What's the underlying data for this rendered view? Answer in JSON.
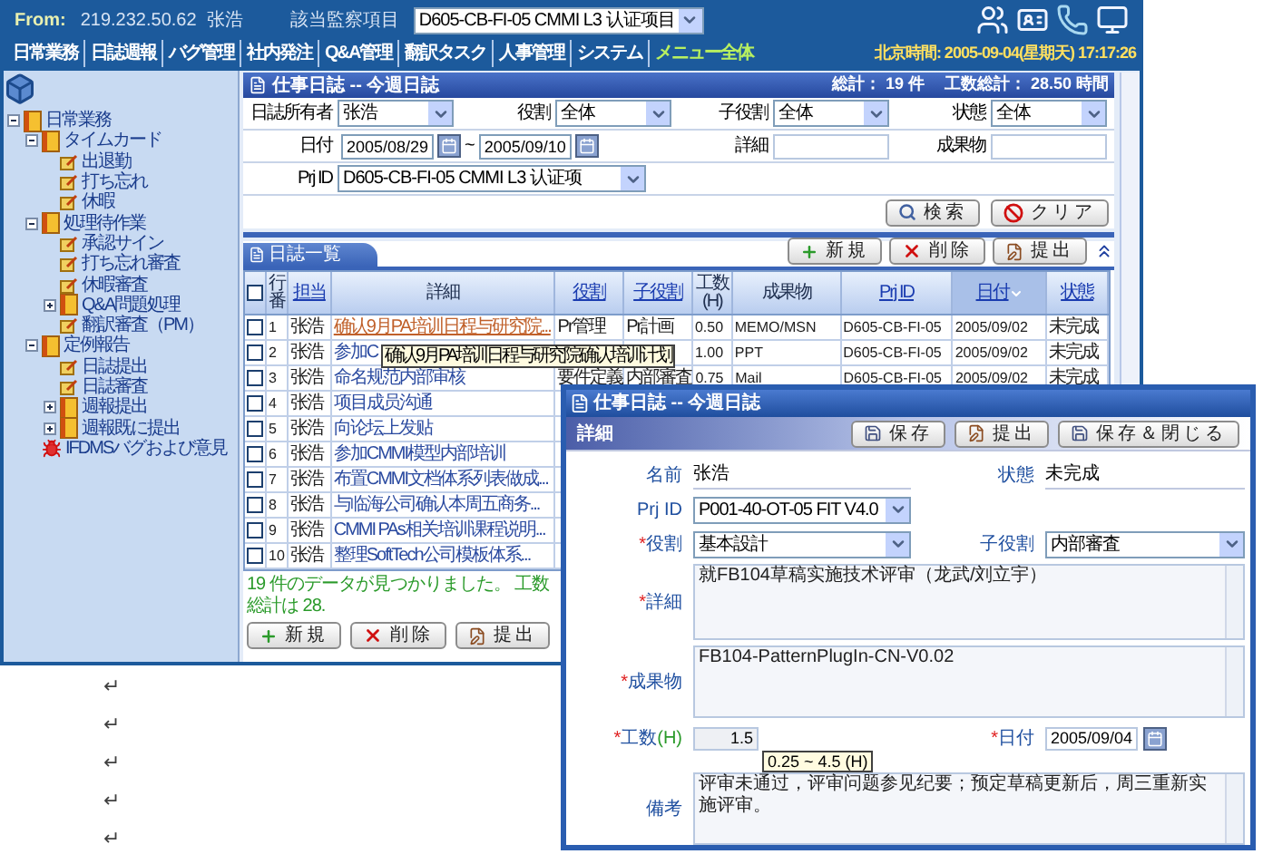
{
  "header": {
    "from_label": "From:",
    "from_value": "219.232.50.62  张浩",
    "project_label": "該当監察項目",
    "project": "D605-CB-FI-05  CMMI L3 认证项目"
  },
  "menu": [
    {
      "label": "日常業務",
      "selected": false
    },
    {
      "label": "日誌週報",
      "selected": false
    },
    {
      "label": "バグ管理",
      "selected": false
    },
    {
      "label": "社内発注",
      "selected": false
    },
    {
      "label": "Q&A管理",
      "selected": false
    },
    {
      "label": "翻訳タスク",
      "selected": false
    },
    {
      "label": "人事管理",
      "selected": false
    },
    {
      "label": "システム",
      "selected": false
    },
    {
      "label": "メニュー全体",
      "selected": true
    }
  ],
  "clock": "北京時間: 2005-09-04(星期天) 17:17:26",
  "sidebar": {
    "tree": [
      {
        "label": "日常業務",
        "kind": "folder",
        "expanded": true,
        "children": [
          {
            "label": "タイムカード",
            "kind": "folder",
            "expanded": true,
            "children": [
              {
                "label": "出退勤",
                "kind": "page"
              },
              {
                "label": "打ち忘れ",
                "kind": "page"
              },
              {
                "label": "休暇",
                "kind": "page"
              }
            ]
          },
          {
            "label": "処理待作業",
            "kind": "folder",
            "expanded": true,
            "children": [
              {
                "label": "承認サイン",
                "kind": "page"
              },
              {
                "label": "打ち忘れ審査",
                "kind": "page"
              },
              {
                "label": "休暇審査",
                "kind": "page"
              },
              {
                "label": "Q&A問題処理",
                "kind": "folder",
                "expanded": false
              },
              {
                "label": "翻訳審査（PM）",
                "kind": "page"
              }
            ]
          },
          {
            "label": "定例報告",
            "kind": "folder",
            "expanded": true,
            "children": [
              {
                "label": "日誌提出",
                "kind": "page"
              },
              {
                "label": "日誌審査",
                "kind": "page"
              },
              {
                "label": "週報提出",
                "kind": "folder",
                "expanded": false
              },
              {
                "label": "週報既に提出",
                "kind": "folder",
                "expanded": false
              }
            ]
          },
          {
            "label": "IFDMSバグおよび意見",
            "kind": "bug"
          }
        ]
      }
    ]
  },
  "panel": {
    "title": "仕事日誌 -- 今週日誌",
    "total": "総計： 19 件",
    "hours_total": "工数総計： 28.50 時間"
  },
  "filters": [
    [
      {
        "label": "日誌所有者",
        "kind": "select",
        "value": "张浩"
      },
      {
        "label": "役割",
        "kind": "select",
        "value": "全体"
      },
      {
        "label": "子役割",
        "kind": "select",
        "value": "全体"
      },
      {
        "label": "状態",
        "kind": "select",
        "value": "全体"
      }
    ],
    [
      {
        "label": "日付",
        "kind": "daterange",
        "from": "2005/08/29",
        "separator": "~",
        "to": "2005/09/10"
      },
      {
        "label": "詳細",
        "kind": "text"
      },
      {
        "label": "成果物",
        "kind": "text"
      }
    ],
    [
      {
        "label": "Prj ID",
        "kind": "wideselect",
        "value": "D605-CB-FI-05  CMMI L3 认证项"
      }
    ]
  ],
  "search_buttons": [
    {
      "label": "検索",
      "kind": "search"
    },
    {
      "label": "クリア",
      "kind": "clear"
    }
  ],
  "list": {
    "tab": "日誌一覧",
    "buttons": [
      {
        "label": "新規",
        "kind": "new"
      },
      {
        "label": "削除",
        "kind": "delete"
      },
      {
        "label": "提出",
        "kind": "submit"
      }
    ],
    "columns": [
      {
        "kind": "checkbox",
        "checked": false
      },
      {
        "kind": "text",
        "label": "行番",
        "link": false,
        "sorted": false
      },
      {
        "kind": "text",
        "label": "担当",
        "link": true,
        "sorted": false
      },
      {
        "kind": "text",
        "label": "詳細",
        "link": false,
        "sorted": false
      },
      {
        "kind": "text",
        "label": "役割",
        "link": true,
        "sorted": false
      },
      {
        "kind": "text",
        "label": "子役割",
        "link": true,
        "sorted": false
      },
      {
        "kind": "text",
        "label": "工数(H)",
        "link": false,
        "sorted": false
      },
      {
        "kind": "text",
        "label": "成果物",
        "link": false,
        "sorted": false
      },
      {
        "kind": "text",
        "label": "Prj ID",
        "link": true,
        "sorted": false
      },
      {
        "kind": "text",
        "label": "日付",
        "link": true,
        "sorted": true
      },
      {
        "kind": "text",
        "label": "状態",
        "link": true,
        "sorted": false
      }
    ],
    "rows": [
      {
        "checked": false,
        "highlighted": true,
        "no": "1",
        "owner": "张浩",
        "detail": "确认9月PA培训日程与研究院...",
        "role": "Pr管理",
        "subrole": "Pr計画",
        "hours": "0.50",
        "deliverable": "MEMO/MSN",
        "prj": "D605-CB-FI-05",
        "date": "2005/09/02",
        "status": "未完成"
      },
      {
        "checked": false,
        "highlighted": false,
        "no": "2",
        "owner": "张浩",
        "detail": "参加C",
        "hours": "1.00",
        "deliverable": "PPT",
        "prj": "D605-CB-FI-05",
        "date": "2005/09/02",
        "status": "未完成"
      },
      {
        "checked": false,
        "highlighted": false,
        "no": "3",
        "owner": "张浩",
        "detail": "命名规范内部审核",
        "role": "要件定義",
        "subrole": "内部審査",
        "hours": "0.75",
        "deliverable": "Mail",
        "prj": "D605-CB-FI-05",
        "date": "2005/09/02",
        "status": "未完成"
      },
      {
        "checked": false,
        "highlighted": false,
        "no": "4",
        "owner": "张浩",
        "detail": "项目成员沟通"
      },
      {
        "checked": false,
        "highlighted": false,
        "no": "5",
        "owner": "张浩",
        "detail": "向论坛上发贴"
      },
      {
        "checked": false,
        "highlighted": false,
        "no": "6",
        "owner": "张浩",
        "detail": "参加CMMI模型内部培训"
      },
      {
        "checked": false,
        "highlighted": false,
        "no": "7",
        "owner": "张浩",
        "detail": "布置CMMI文档体系列表做成..."
      },
      {
        "checked": false,
        "highlighted": false,
        "no": "8",
        "owner": "张浩",
        "detail": "与临海公司确认本周五商务..."
      },
      {
        "checked": false,
        "highlighted": false,
        "no": "9",
        "owner": "张浩",
        "detail": "CMMI PAs相关培训课程说明..."
      },
      {
        "checked": false,
        "highlighted": false,
        "no": "10",
        "owner": "张浩",
        "detail": "整理SoftTech公司模板体系..."
      }
    ],
    "tooltip": "确认9月PA培训日程与研究院确认培训计划",
    "footer": "19 件のデータが見つかりました。 工数総計は 28.",
    "footer_buttons": [
      {
        "label": "新規",
        "kind": "new"
      },
      {
        "label": "削除",
        "kind": "delete"
      },
      {
        "label": "提出",
        "kind": "submit"
      }
    ]
  },
  "dialog": {
    "title": "仕事日誌 -- 今週日誌",
    "section": "詳細",
    "buttons": [
      {
        "label": "保存",
        "kind": "save"
      },
      {
        "label": "提出",
        "kind": "submit"
      },
      {
        "label": "保存＆閉じる",
        "kind": "save"
      }
    ],
    "name": {
      "label": "名前",
      "value": "张浩"
    },
    "status": {
      "label": "状態",
      "value": "未完成"
    },
    "prj": {
      "label": "Prj ID",
      "value": "P001-40-OT-05  FIT V4.0"
    },
    "role": {
      "label": "役割",
      "mark": "*",
      "value": "基本設計"
    },
    "subrole": {
      "label": "子役割",
      "value": "内部審査"
    },
    "detail": {
      "label": "詳細",
      "mark": "*",
      "value": "就FB104草稿实施技术评审（龙武/刘立宇）"
    },
    "deliverable": {
      "label": "成果物",
      "mark": "*",
      "value": "FB104-PatternPlugIn-CN-V0.02"
    },
    "hours": {
      "label": "工数",
      "unit": "(H)",
      "mark": "*",
      "value": "1.5",
      "hint": "0.25 ~ 4.5 (H)"
    },
    "date": {
      "label": "日付",
      "mark": "*",
      "value": "2005/09/04"
    },
    "remarks": {
      "label": "備考",
      "value": "评审未通过，评审问题参见纪要；预定草稿更新后，周三重新实施评审。"
    }
  },
  "paragraph_marks": [
    "↵",
    "↵",
    "↵",
    "↵",
    "↵"
  ]
}
